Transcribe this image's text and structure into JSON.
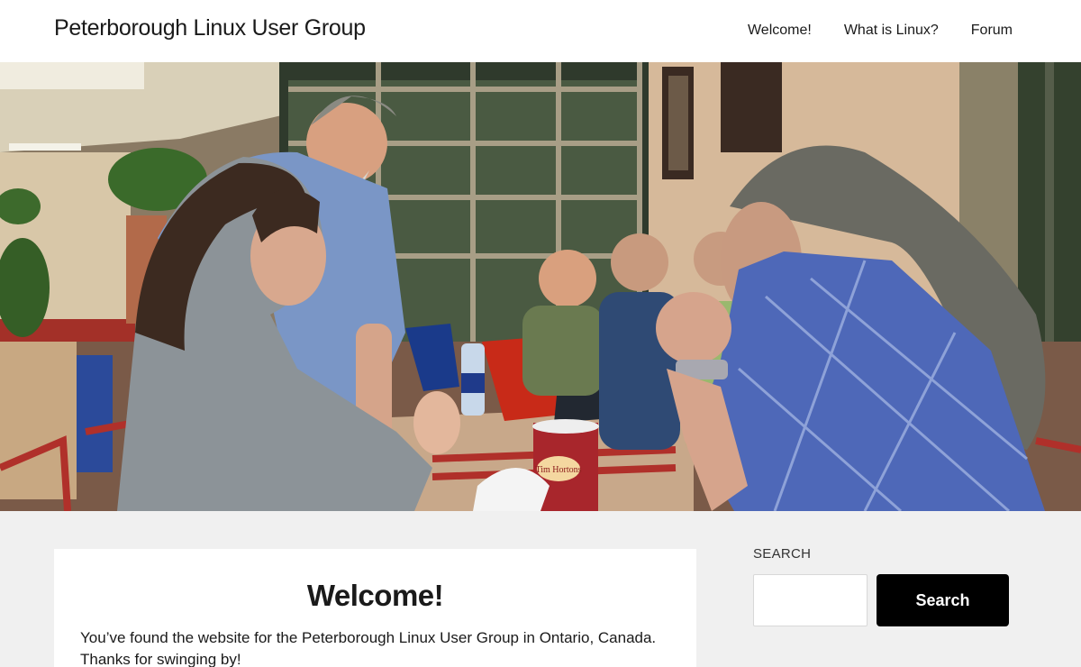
{
  "header": {
    "site_title": "Peterborough Linux User Group",
    "nav": [
      {
        "label": "Welcome!"
      },
      {
        "label": "What is Linux?"
      },
      {
        "label": "Forum"
      }
    ]
  },
  "hero": {
    "cup_logo_text": "Tim Hortons"
  },
  "main": {
    "title": "Welcome!",
    "text": "You’ve found the website for the Peterborough Linux User Group in Ontario, Canada. Thanks for swinging by!"
  },
  "sidebar": {
    "search_label": "SEARCH",
    "search_button": "Search",
    "search_value": ""
  },
  "colors": {
    "header_bg": "#ffffff",
    "page_bg": "#f0f0f0",
    "button_bg": "#000000",
    "button_text": "#ffffff"
  }
}
